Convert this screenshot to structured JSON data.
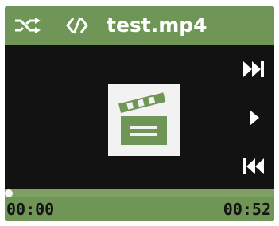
{
  "header": {
    "shuffle_icon": "shuffle-icon",
    "repeat_icon": "repeat-icon",
    "title": "test.mp4"
  },
  "media": {
    "thumbnail_icon": "video-clapperboard-icon"
  },
  "controls": {
    "next_icon": "next-track-icon",
    "play_icon": "play-icon",
    "previous_icon": "previous-track-icon"
  },
  "playback": {
    "elapsed": "00:00",
    "duration": "00:52",
    "progress_fraction": 0.0
  },
  "colors": {
    "accent_green": "#6f9656",
    "screen_background": "#121212",
    "text_light": "#ffffff",
    "text_dark": "#141414"
  }
}
